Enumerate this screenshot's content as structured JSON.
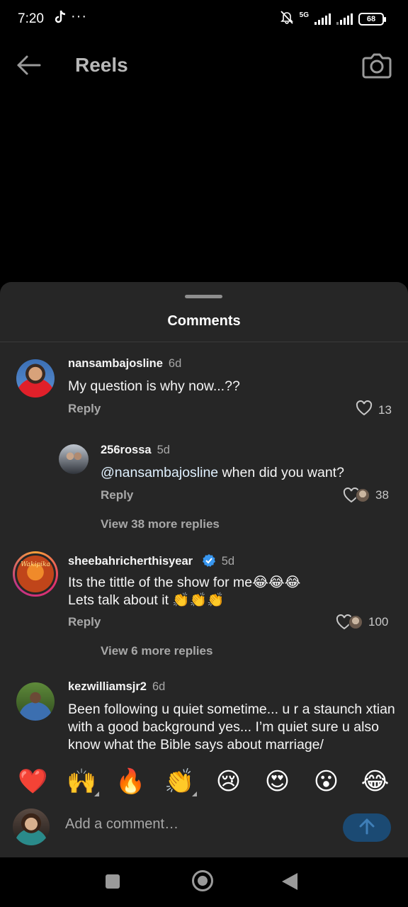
{
  "status_bar": {
    "time": "7:20",
    "more": "···",
    "network": "5G",
    "battery": "68"
  },
  "header": {
    "title": "Reels"
  },
  "sheet": {
    "title": "Comments"
  },
  "comments": [
    {
      "username": "nansambajosline",
      "time": "6d",
      "text": "My question is why now...??",
      "reply_label": "Reply",
      "likes": "13"
    },
    {
      "username": "256rossa",
      "time": "5d",
      "mention": "@nansambajosline",
      "text": " when did you want?",
      "reply_label": "Reply",
      "likes": "38"
    },
    {
      "view_more": "View 38 more replies"
    },
    {
      "username": "sheebahricherthisyear",
      "time": "5d",
      "line1": "Its the tittle of the show for me😂😂😂",
      "line2": "Lets talk about it 👏👏👏",
      "reply_label": "Reply",
      "likes": "100",
      "avatar_text": "Wakipika"
    },
    {
      "view_more": "View 6 more replies"
    },
    {
      "username": "kezwilliamsjr2",
      "time": "6d",
      "text": "Been following u quiet sometime... u r a staunch xtian with a good background yes... I’m quiet sure u also know what the Bible says about marriage/"
    }
  ],
  "emoji_bar": [
    "❤️",
    "🙌",
    "🔥",
    "👏",
    "😢",
    "😍",
    "😮",
    "😂"
  ],
  "composer": {
    "placeholder": "Add a comment…"
  },
  "colors": {
    "sheet_bg": "#262626",
    "send_button": "#1b4a73",
    "verified": "#3897f0"
  }
}
